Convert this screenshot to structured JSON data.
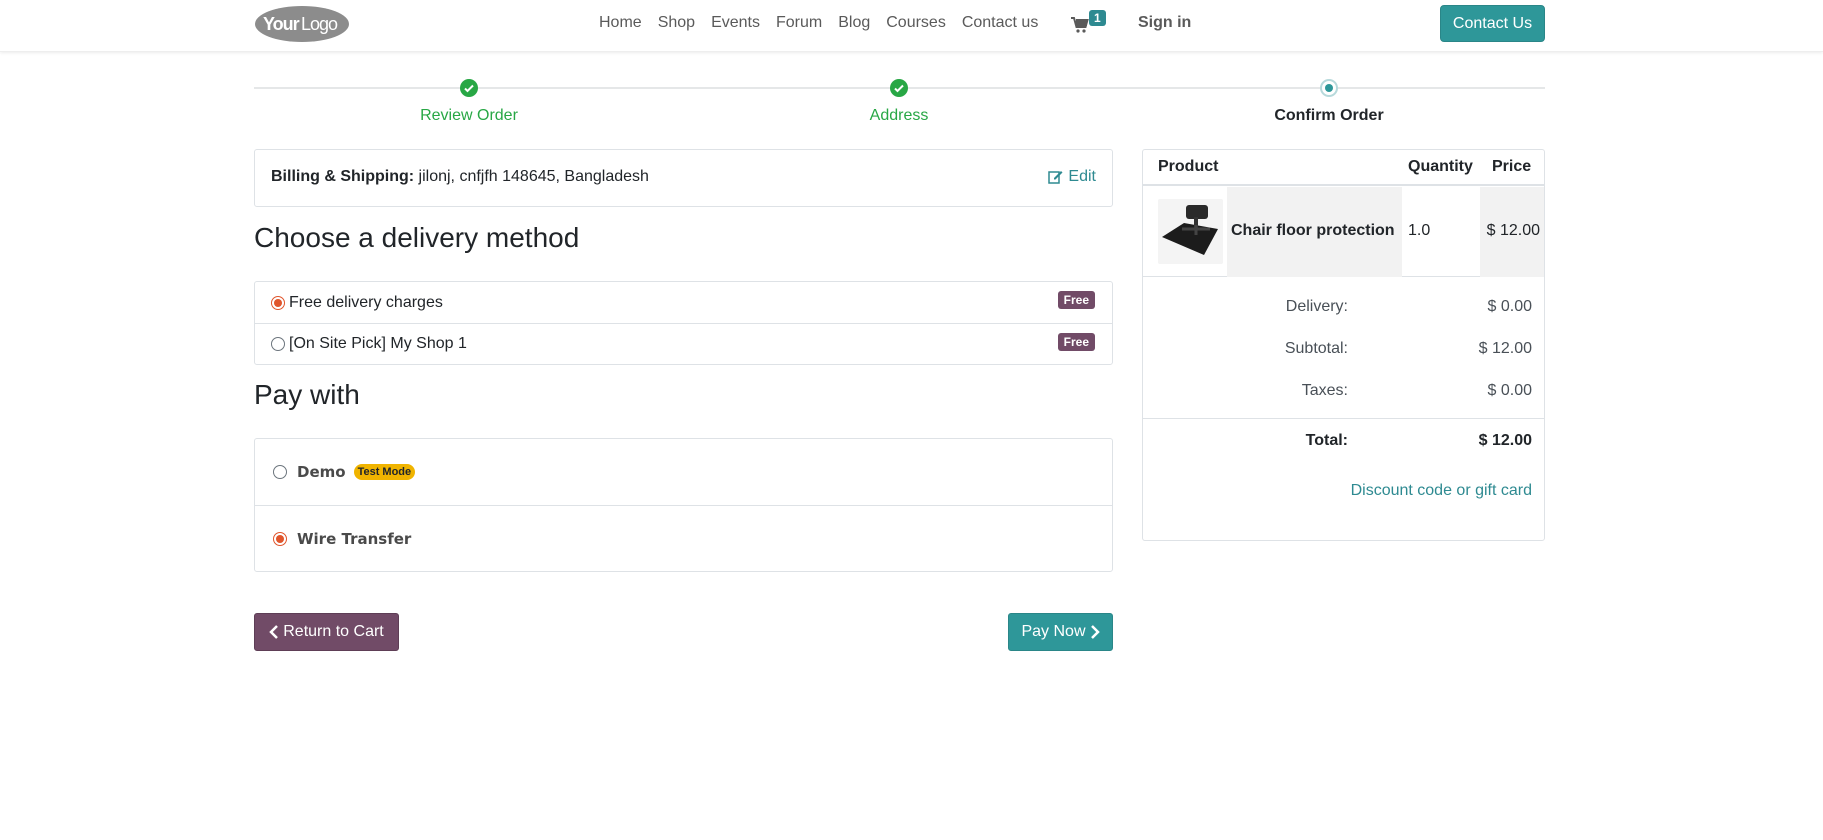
{
  "header": {
    "logo_text": "YourLogo",
    "nav": [
      "Home",
      "Shop",
      "Events",
      "Forum",
      "Blog",
      "Courses",
      "Contact us"
    ],
    "cart_count": "1",
    "signin": "Sign in",
    "contact_button": "Contact Us"
  },
  "wizard": {
    "steps": [
      {
        "label": "Review Order",
        "state": "done"
      },
      {
        "label": "Address",
        "state": "done"
      },
      {
        "label": "Confirm Order",
        "state": "current"
      }
    ]
  },
  "billing": {
    "label": "Billing & Shipping:",
    "address": " jilonj, cnfjfh 148645, Bangladesh",
    "edit": "Edit"
  },
  "delivery": {
    "heading": "Choose a delivery method",
    "options": [
      {
        "label": "Free delivery charges",
        "badge": "Free",
        "selected": true
      },
      {
        "label": "[On Site Pick] My Shop 1",
        "badge": "Free",
        "selected": false
      }
    ]
  },
  "payment": {
    "heading": "Pay with",
    "options": [
      {
        "label": "Demo",
        "badge": "Test Mode",
        "selected": false
      },
      {
        "label": "Wire Transfer",
        "badge": "",
        "selected": true
      }
    ]
  },
  "buttons": {
    "return": "Return to Cart",
    "pay": "Pay Now"
  },
  "summary": {
    "headers": {
      "product": "Product",
      "quantity": "Quantity",
      "price": "Price"
    },
    "item": {
      "name": "Chair floor protection",
      "quantity": "1.0",
      "price": "$ 12.00"
    },
    "delivery_label": "Delivery:",
    "delivery_value": "$ 0.00",
    "subtotal_label": "Subtotal:",
    "subtotal_value": "$ 12.00",
    "taxes_label": "Taxes:",
    "taxes_value": "$ 0.00",
    "total_label": "Total:",
    "total_value": "$ 12.00",
    "discount_link": "Discount code or gift card"
  },
  "colors": {
    "primary": "#2e9799",
    "secondary": "#714b67",
    "success": "#28a745",
    "radio_checked": "#e0552c",
    "badge_warning": "#f0b400"
  }
}
